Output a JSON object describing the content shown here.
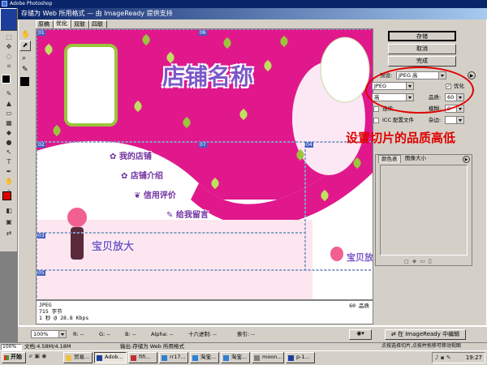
{
  "app": {
    "title": "Adobe Photoshop"
  },
  "dialog": {
    "title": "存储为 Web 所用格式 — 由 ImageReady 提供支持",
    "tabs": [
      {
        "label": "原稿"
      },
      {
        "label": "优化"
      },
      {
        "label": "双联"
      },
      {
        "label": "四联"
      }
    ]
  },
  "canvas": {
    "shop_title": "店铺名称",
    "menu_items": [
      "我的店铺",
      "店铺介绍",
      "信用评价",
      "给我留言"
    ],
    "banner": "宝贝放大",
    "slice_tags": [
      "01",
      "02",
      "03",
      "04",
      "05",
      "06",
      "07"
    ],
    "colors": {
      "pink": "#e0188c",
      "leaf_green": "#9bc43c",
      "purple": "#7b58c8",
      "light_pink": "#fde6ef"
    }
  },
  "info": {
    "format": "JPEG",
    "size": "715 字节",
    "time": "1 秒 @ 28.8 Kbps",
    "quality_readout": "60 品质"
  },
  "buttons": {
    "save": "存储",
    "cancel": "取消",
    "done": "完成",
    "edit_imageready": "在 ImageReady 中编辑"
  },
  "settings": {
    "preset_label": "预设:",
    "preset_value": "JPEG 高",
    "format_value": "JPEG",
    "optimized_label": "优化",
    "compression_value": "高",
    "quality_label": "品质:",
    "quality_value": "60",
    "progressive_label": "连续",
    "blur_label": "模糊:",
    "blur_value": "0",
    "icc_label": "ICC 配置文件",
    "matte_label": "杂边:"
  },
  "annotation": "设置切片的品质高低",
  "palette_tabs": {
    "color_table": "颜色表",
    "image_size": "图像大小"
  },
  "zoom": {
    "value": "100%"
  },
  "pixel_readout": {
    "r": "R:  --",
    "g": "G:  --",
    "b": "B:  --",
    "alpha": "Alpha:  --",
    "hex": "十六进制:  --",
    "index": "索引:  --"
  },
  "status": {
    "doc_size": "文档:4.58M/4.18M",
    "output_msg": "输出:存储为 Web 所用格式",
    "hint": "点按选择切片,点按并拖移可移动视图"
  },
  "taskbar": {
    "start": "开始",
    "tasks": [
      "贸易...",
      "Adob...",
      "fifi...",
      "rr17...",
      "淘宝...",
      "淘宝...",
      "moon...",
      "p-1..."
    ],
    "clock": "19:27"
  }
}
